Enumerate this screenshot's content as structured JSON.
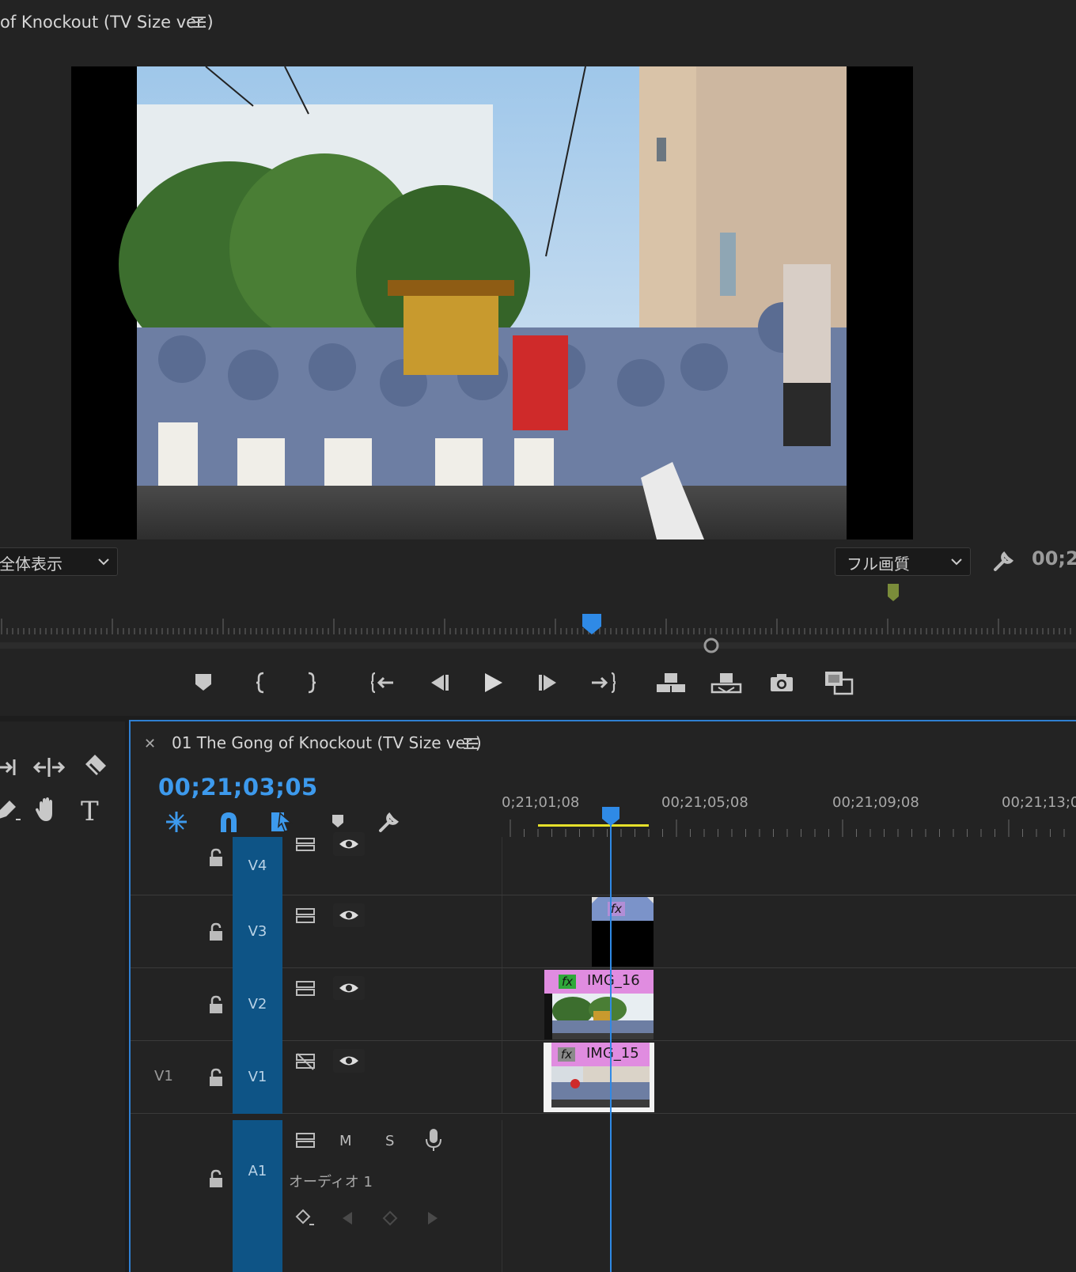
{
  "program_monitor": {
    "title": "of Knockout (TV Size ver.)",
    "zoom_level": "全体表示",
    "quality": "フル画質",
    "timecode": "00;2",
    "transport": [
      {
        "name": "add-marker-button",
        "icon": "marker-icon"
      },
      {
        "name": "mark-in-button",
        "icon": "brace-left-icon"
      },
      {
        "name": "mark-out-button",
        "icon": "brace-right-icon"
      },
      {
        "name": "go-to-in-button",
        "icon": "go-to-in-icon"
      },
      {
        "name": "step-back-button",
        "icon": "step-back-icon"
      },
      {
        "name": "play-button",
        "icon": "play-icon"
      },
      {
        "name": "step-forward-button",
        "icon": "step-forward-icon"
      },
      {
        "name": "go-to-out-button",
        "icon": "go-to-out-icon"
      },
      {
        "name": "lift-button",
        "icon": "lift-icon"
      },
      {
        "name": "extract-button",
        "icon": "extract-icon"
      },
      {
        "name": "export-frame-button",
        "icon": "camera-icon"
      },
      {
        "name": "compare-view-button",
        "icon": "compare-icon"
      }
    ]
  },
  "tools": [
    {
      "name": "ripple-edit-tool",
      "icon": "ripple-edit-icon"
    },
    {
      "name": "slip-tool",
      "icon": "slip-icon"
    },
    {
      "name": "razor-tool",
      "icon": "razor-icon"
    },
    {
      "name": "pen-tool",
      "icon": "pen-icon"
    },
    {
      "name": "hand-tool",
      "icon": "hand-icon"
    },
    {
      "name": "type-tool",
      "icon": "type-icon",
      "label": "T"
    }
  ],
  "timeline": {
    "title": "01 The Gong of Knockout (TV Size ver.)",
    "timecode": "00;21;03;05",
    "ruler_labels": [
      "0;21;01;08",
      "00;21;05;08",
      "00;21;09;08",
      "00;21;13;0"
    ],
    "tracks": [
      {
        "id": "V4",
        "source": ""
      },
      {
        "id": "V3",
        "source": ""
      },
      {
        "id": "V2",
        "source": ""
      },
      {
        "id": "V1",
        "source": "V1"
      },
      {
        "id": "A1",
        "source": "",
        "name": "オーディオ 1",
        "mute": "M",
        "solo": "S"
      }
    ],
    "clips": [
      {
        "track": "V3",
        "fx": "fx"
      },
      {
        "track": "V2",
        "fx": "fx",
        "name": "IMG_16"
      },
      {
        "track": "V1",
        "fx": "fx",
        "name": "IMG_15"
      }
    ]
  },
  "colors": {
    "accent": "#2f8ae6",
    "track_header": "#0e5486",
    "clip_label": "#e08ce0",
    "in_out_bar": "#e5e02a",
    "timecode": "#3d9aed"
  }
}
